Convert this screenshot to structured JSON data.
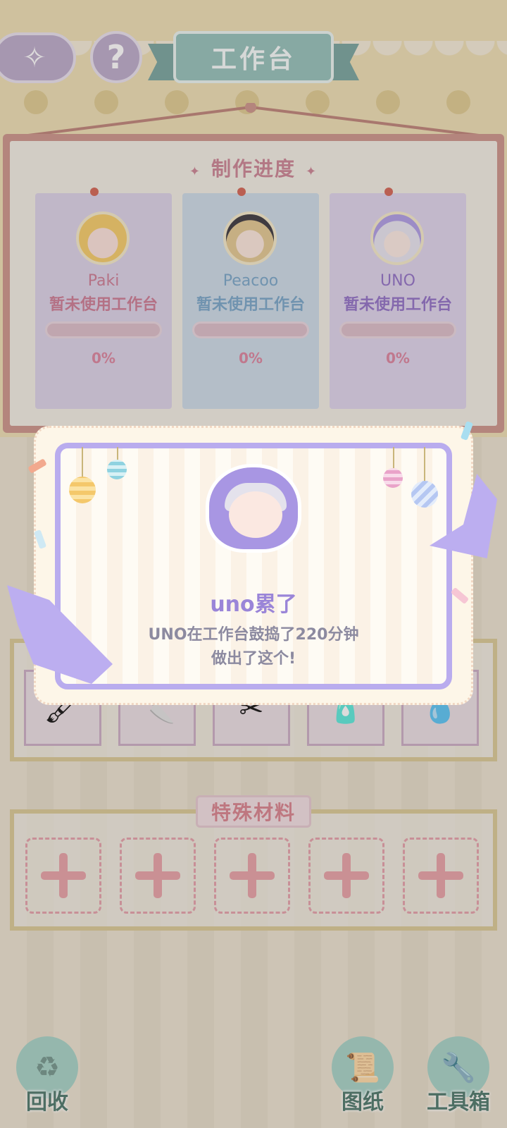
{
  "header": {
    "back_icon": "back-arrow-icon",
    "help_label": "?",
    "title": "工作台"
  },
  "progress": {
    "title": "制作进度",
    "cards": [
      {
        "name": "Paki",
        "status": "暂未使用工作台",
        "percent_label": "0%",
        "progress": 0,
        "name_color": "#c9728c",
        "status_color": "#c9728c",
        "card_color": "#d9cfe6"
      },
      {
        "name": "Peacoo",
        "status": "暂未使用工作台",
        "percent_label": "0%",
        "progress": 0,
        "name_color": "#6e9fc4",
        "status_color": "#6e9fc4",
        "card_color": "#c8d8e6"
      },
      {
        "name": "UNO",
        "status": "暂未使用工作台",
        "percent_label": "0%",
        "progress": 0,
        "name_color": "#8866c2",
        "status_color": "#8866c2",
        "card_color": "#dbd0ea"
      }
    ]
  },
  "modal": {
    "title": "uno累了",
    "line1": "UNO在工作台鼓捣了220分钟",
    "line2": "做出了这个!"
  },
  "tools": {
    "items": [
      "paintbrush-icon",
      "craft-knife-icon",
      "scissors-icon",
      "glue-bottle-icon",
      "dropper-icon"
    ]
  },
  "special_materials": {
    "title": "特殊材料",
    "slots": 5
  },
  "bottom_nav": {
    "recycle_label": "回收",
    "blueprint_label": "图纸",
    "toolbox_label": "工具箱"
  }
}
